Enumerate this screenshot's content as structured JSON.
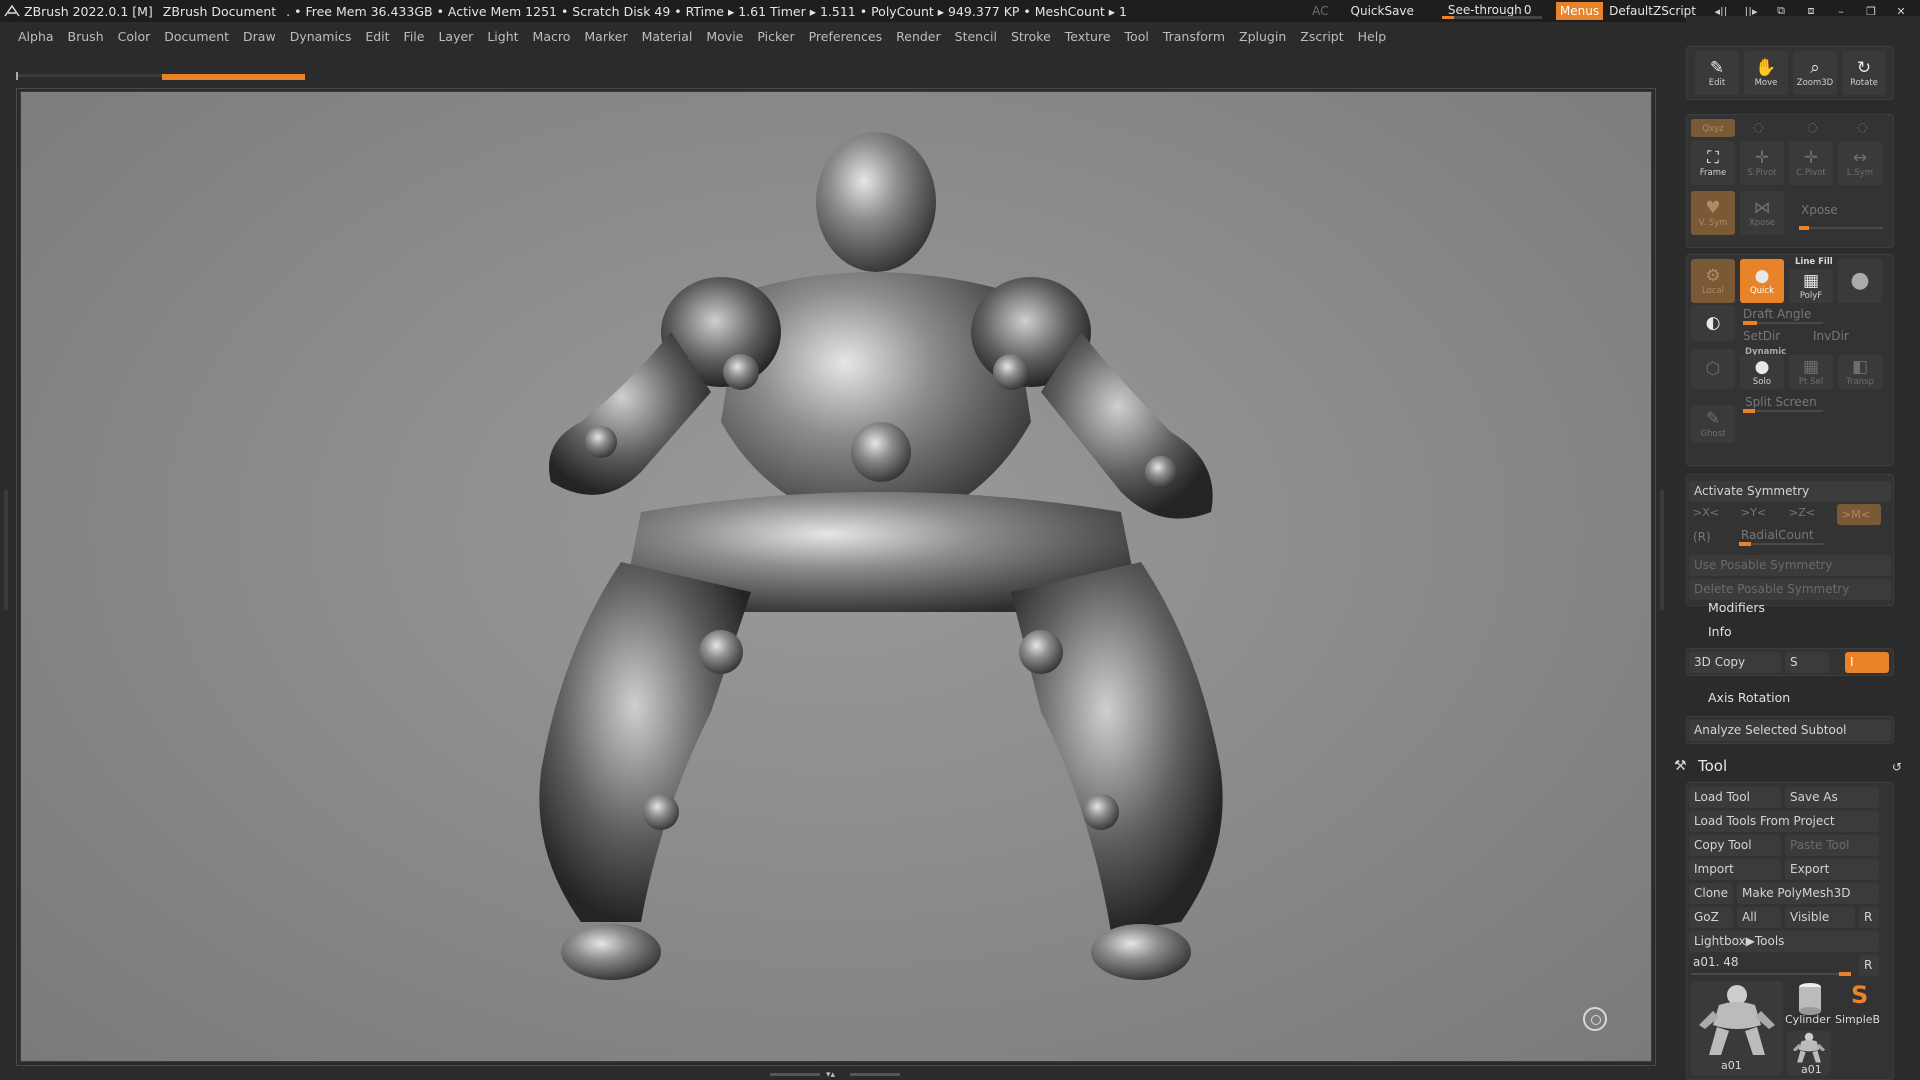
{
  "titlebar": {
    "app": "ZBrush 2022.0.1 [M]",
    "doc": "ZBrush Document",
    "stats": ". • Free Mem 36.433GB • Active Mem 1251 • Scratch Disk 49 •  RTime ▸ 1.61 Timer ▸ 1.511 • PolyCount ▸ 949.377 KP  • MeshCount ▸ 1",
    "ac": "AC",
    "quicksave": "QuickSave",
    "seethrough_label": "See-through",
    "seethrough_value": "0",
    "menus": "Menus",
    "script": "DefaultZScript"
  },
  "menubar": [
    "Alpha",
    "Brush",
    "Color",
    "Document",
    "Draw",
    "Dynamics",
    "Edit",
    "File",
    "Layer",
    "Light",
    "Macro",
    "Marker",
    "Material",
    "Movie",
    "Picker",
    "Preferences",
    "Render",
    "Stencil",
    "Stroke",
    "Texture",
    "Tool",
    "Transform",
    "Zplugin",
    "Zscript",
    "Help"
  ],
  "view_buttons": {
    "edit": "Edit",
    "move": "Move",
    "zoom3d": "Zoom3D",
    "rotate": "Rotate"
  },
  "transform": {
    "xyz": "Qxyz",
    "frame": "Frame",
    "spivot": "S.Pivot",
    "cpivot": "C.Pivot",
    "lsym": "L.Sym",
    "vsym": "V. Sym",
    "xpose_btn": "Xpose",
    "xpose_label": "Xpose",
    "local": "Local",
    "quick": "Quick",
    "linefill": "Line Fill",
    "polyf": "PolyF",
    "draft_angle": "Draft Angle",
    "setdir": "SetDir",
    "invdir": "InvDir",
    "dynamic": "Dynamic",
    "solo": "Solo",
    "ptsel": "Pt Sel",
    "transp": "Transp",
    "split_screen": "Split Screen",
    "ghost": "Ghost"
  },
  "symmetry": {
    "activate": "Activate Symmetry",
    "x": ">X<",
    "y": ">Y<",
    "z": ">Z<",
    "m": ">M<",
    "r": "(R)",
    "radial": "RadialCount",
    "use_posable": "Use Posable Symmetry",
    "delete_posable": "Delete Posable Symmetry"
  },
  "modifiers": "Modifiers",
  "info": "Info",
  "copy3d": {
    "label": "3D Copy",
    "s": "S",
    "i": "I"
  },
  "axis_rotation": "Axis Rotation",
  "analyze": "Analyze Selected Subtool",
  "tool": {
    "title": "Tool",
    "load_tool": "Load Tool",
    "save_as": "Save As",
    "load_from_project": "Load Tools From Project",
    "copy_tool": "Copy Tool",
    "paste_tool": "Paste Tool",
    "import": "Import",
    "export": "Export",
    "clone": "Clone",
    "make_polymesh": "Make PolyMesh3D",
    "goz": "GoZ",
    "all": "All",
    "visible": "Visible",
    "r": "R",
    "lightbox": "Lightbox▶Tools",
    "current": "a01. 48",
    "r2": "R",
    "thumb_a01": "a01",
    "thumb_cyl": "Cylinder",
    "thumb_simple": "SimpleB",
    "thumb_a01_small": "a01"
  }
}
